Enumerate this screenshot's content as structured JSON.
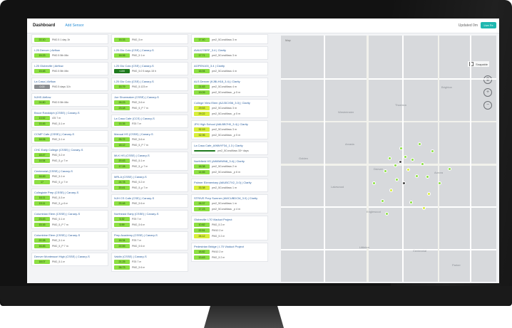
{
  "header": {
    "title": "Dashboard",
    "add_sensor": "Add Sensor",
    "updated": "Updated 0m",
    "live_button": "Live Fe"
  },
  "colors": {
    "good": "#8cdf42",
    "moderate": "#d8ee3a",
    "dark_green": "#1e7a1e",
    "gray": "#8a8d90",
    "accent": "#1fb8b0"
  },
  "columns": [
    {
      "cards": [
        {
          "title": "",
          "rows": [
            {
              "value": "22.10",
              "label": "PM2.5 1 day 1h",
              "color": "good"
            }
          ]
        },
        {
          "title": "I-25 Denver | Airflow",
          "rows": [
            {
              "value": "15.23",
              "label": "PM2.5 5th Min",
              "color": "good"
            }
          ]
        },
        {
          "title": "I-25 Globeville | Airflow",
          "rows": [
            {
              "value": "15.48",
              "label": "PM2.5 5th Min",
              "color": "good"
            }
          ]
        },
        {
          "title": "La Casa | Airflow",
          "rows": [
            {
              "value": "0.00",
              "label": "PM2.5 days 11h",
              "color": "gray"
            }
          ]
        },
        {
          "title": "NJHS Airflow",
          "rows": [
            {
              "value": "24.80",
              "label": "PM2.5 5th Min",
              "color": "good"
            }
          ]
        },
        {
          "title": "Bruce Randolph (CSSE) | Canary-S",
          "rows": [
            {
              "value": "13.52",
              "label": "r25 7 m",
              "color": "good"
            },
            {
              "value": "15.45",
              "label": "PM2_5.1 m",
              "color": "good"
            }
          ]
        },
        {
          "title": "CCMP Cafe (CSSE) | Canary-S",
          "rows": [
            {
              "value": "18.06",
              "label": "PM2_5.1 m",
              "color": "good"
            }
          ]
        },
        {
          "title": "CHC Early College (CSSE) | Canary-S",
          "rows": [
            {
              "value": "18.47",
              "label": "PM2_5.2 m",
              "color": "good"
            },
            {
              "value": "14.54",
              "label": "PM2_5_p 7 m",
              "color": "good"
            }
          ]
        },
        {
          "title": "Centennial (CSSE) | Canary-S",
          "rows": [
            {
              "value": "16.49",
              "label": "PM2_5.1 m",
              "color": "good"
            },
            {
              "value": "17",
              "label": "PM2_5_p 7 m",
              "color": "good"
            }
          ]
        },
        {
          "title": "Collegiate Prep (CSSE) | Canary-S",
          "rows": [
            {
              "value": "16.11",
              "label": "PM2_5.3 m",
              "color": "good"
            },
            {
              "value": "15.11",
              "label": "PM2_5_p 6 m",
              "color": "good"
            }
          ]
        },
        {
          "title": "Columbian Elem (CSSE) | Canary-S",
          "rows": [
            {
              "value": "23.43",
              "label": "PM2_5.1 m",
              "color": "good"
            },
            {
              "value": "15.16",
              "label": "PM2_5_P 7 m",
              "color": "good"
            }
          ]
        },
        {
          "title": "Columbine Elem (CSSE) | Canary-S",
          "rows": [
            {
              "value": "22.28",
              "label": "PM2_5.1 m",
              "color": "good"
            },
            {
              "value": "16.45",
              "label": "PM2_5_P 7 m",
              "color": "good"
            }
          ]
        },
        {
          "title": "Denver Montessori High (CSSE) | Canary-S",
          "rows": [
            {
              "value": "18.07",
              "label": "PM2_5.1 m",
              "color": "good"
            }
          ]
        }
      ]
    },
    {
      "cards": [
        {
          "title": "",
          "rows": [
            {
              "value": "15.33",
              "label": "PM2_5 m",
              "color": "good"
            }
          ]
        },
        {
          "title": "I-25 Gio Colo (CSE) | Canary-S",
          "rows": [
            {
              "value": "16.06",
              "label": "PM2_5 1 m",
              "color": "good"
            }
          ]
        },
        {
          "title": "I-25 Gio Colo (CSE) | Canary-S",
          "rows": [
            {
              "value": "<100",
              "label": "PM2_5.0 5 days 15 h",
              "color": "dark_green"
            }
          ]
        },
        {
          "title": "I-25 Gio Colo (CSE) | Canary-S",
          "rows": [
            {
              "value": "15.79",
              "label": "PM2_5.123 m",
              "color": "good"
            }
          ]
        },
        {
          "title": "Joe Shoemaker (CSSE) | Canary-S",
          "rows": [
            {
              "value": "26.23",
              "label": "PM2_5.6 m",
              "color": "good"
            },
            {
              "value": "23.18",
              "label": "PM2_5_P 7 m",
              "color": "good"
            }
          ]
        },
        {
          "title": "La Casa Cafe (CCS) | Canary-S",
          "rows": [
            {
              "value": "15.35",
              "label": "P25 7 m",
              "color": "good"
            }
          ]
        },
        {
          "title": "Manual HS (CSSE) | Canary-S",
          "rows": [
            {
              "value": "25.72",
              "label": "PM2_5.6 m",
              "color": "good"
            },
            {
              "value": "18.12",
              "label": "PM2_5_P 7 m",
              "color": "good"
            }
          ]
        },
        {
          "title": "MLK HS (CSSE) | Canary-S",
          "rows": [
            {
              "value": "20.43",
              "label": "PM2_5.1 m",
              "color": "good"
            },
            {
              "value": "17.28",
              "label": "PM2_5_p 7 m",
              "color": "good"
            }
          ]
        },
        {
          "title": "MRLA (CSSE) | Canary-S",
          "rows": [
            {
              "value": "24.78",
              "label": "PM2_5.2 m",
              "color": "good"
            },
            {
              "value": "20.41",
              "label": "PM2_5_p 7 m",
              "color": "good"
            }
          ]
        },
        {
          "title": "NJH CS Cafe (CSE) | Canary-S",
          "rows": [
            {
              "value": "25.48",
              "label": "PM2_5 6 m",
              "color": "good"
            }
          ]
        },
        {
          "title": "Northeast Early (CSSE) | Canary-S",
          "rows": [
            {
              "value": "5.32",
              "label": "P25 7 m",
              "color": "good"
            },
            {
              "value": "5.99",
              "label": "PM2_5 6 m",
              "color": "good"
            }
          ]
        },
        {
          "title": "Prep Academy (CSSE) | Canary-S",
          "rows": [
            {
              "value": "16.34",
              "label": "P25 7 m",
              "color": "good"
            },
            {
              "value": "22.59",
              "label": "PM2_5 6 m",
              "color": "good"
            }
          ]
        },
        {
          "title": "Valdin (CSSE) | Canary-S",
          "rows": [
            {
              "value": "21.25",
              "label": "P25 7 m",
              "color": "good"
            },
            {
              "value": "26.73",
              "label": "PM2_5 6 m",
              "color": "good"
            }
          ]
        }
      ]
    },
    {
      "cards": [
        {
          "title": "",
          "rows": [
            {
              "value": "17.40",
              "label": "pm2_5ConcMass 3 m",
              "color": "good"
            }
          ]
        },
        {
          "title": "AVAX27BRF_3.4 | Clarity",
          "rows": [
            {
              "value": "17.71",
              "label": "pm2_5ConcMass 3 m",
              "color": "good"
            }
          ]
        },
        {
          "title": "AGPEN100_3.4 | Clarity",
          "rows": [
            {
              "value": "16.94",
              "label": "pm2_5ConcMass 4 m",
              "color": "good"
            }
          ]
        },
        {
          "title": "ALS Denver (KJBLH18_3.4) | Clarity",
          "rows": [
            {
              "value": "21.63",
              "label": "pm2_5ConcMass 4 m",
              "color": "good"
            },
            {
              "value": "19.09",
              "label": "pm2_5ConcMass _p 5 m",
              "color": "good"
            }
          ]
        },
        {
          "title": "College View Elem (A2J3CX56_3.0) | Clarity",
          "rows": [
            {
              "value": "29.53",
              "label": "pm2_5ConcMass 3 m",
              "color": "moderate"
            },
            {
              "value": "29.22",
              "label": "pm2_5ConcMass _p 5 m",
              "color": "moderate"
            }
          ]
        },
        {
          "title": "JFK High School (A6LBB7H0_3.4) | Clarity",
          "rows": [
            {
              "value": "32.19",
              "label": "pm2_5ConcMass 3 m",
              "color": "moderate"
            },
            {
              "value": "32.96",
              "label": "pm2_5ConcMass _p 5 m",
              "color": "moderate"
            }
          ]
        },
        {
          "title": "La Casa Cafe_A96NYF34_1.3 | Clarity",
          "rows": [
            {
              "value": "",
              "label": "pm2_5ConcMass 33+ days",
              "color": "dark_green"
            }
          ]
        },
        {
          "title": "Northfield HS (A9I8WWN8_3.4) | Clarity",
          "rows": [
            {
              "value": "18.38",
              "label": "pm2_5ConcMass 2 m",
              "color": "good"
            },
            {
              "value": "14.65",
              "label": "pm2_5ConcMass _p 6 m",
              "color": "good"
            }
          ]
        },
        {
          "title": "Palmer Elementary (A6UBC7X2_3.0) | Clarity",
          "rows": [
            {
              "value": "33.38",
              "label": "pm2_5ConcMass 1 m",
              "color": "moderate"
            }
          ]
        },
        {
          "title": "STRIVE Prep Sumner (AWCUBDCM_3.0) | Clarity",
          "rows": [
            {
              "value": "26.37",
              "label": "pm2_5ConcMass 1 m",
              "color": "good"
            },
            {
              "value": "17.23",
              "label": "pm2_5ConcMass _p 4 m",
              "color": "good"
            }
          ]
        },
        {
          "title": "Globeville I-70 Viaduct Project",
          "rows": [
            {
              "value": "10.82",
              "label": "PM2_5 2 m",
              "color": "good"
            },
            {
              "value": "22.51",
              "label": "PM10 2 m",
              "color": "good"
            },
            {
              "value": "26.12",
              "label": "PM2_5 2 m",
              "color": "moderate"
            }
          ]
        },
        {
          "title": "Pedestrian Bridge | I-70 Viaduct Project",
          "rows": [
            {
              "value": "18.82",
              "label": "PM10 2 m",
              "color": "good"
            },
            {
              "value": "13.43",
              "label": "PM2_5 2 m",
              "color": "good"
            }
          ]
        }
      ]
    }
  ],
  "map": {
    "view_label": "Map",
    "layer_label": "Snapable",
    "zoom_in": "+",
    "zoom_out": "−",
    "locate": "◉",
    "places": [
      "Thornton",
      "Westminster",
      "Arvada",
      "Lakewood",
      "Denver",
      "Aurora",
      "Englewood",
      "Littleton",
      "Centennial",
      "Golden",
      "Brighton",
      "Parker"
    ],
    "marker_count": 24
  }
}
